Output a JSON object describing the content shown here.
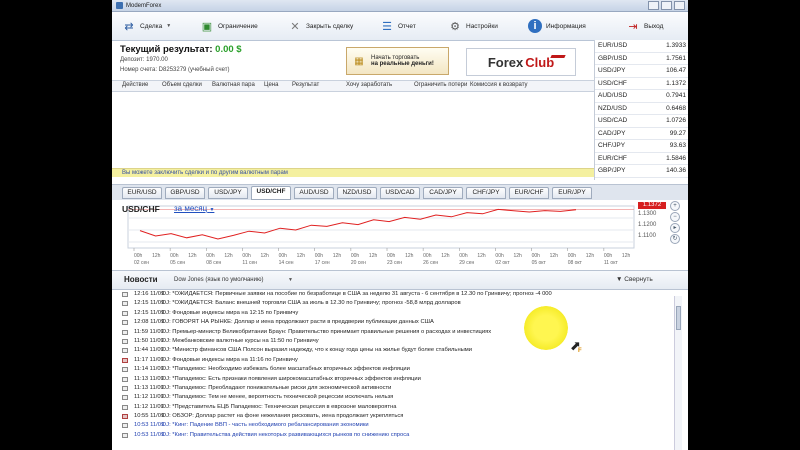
{
  "window": {
    "title": "ModemForex"
  },
  "toolbar": [
    {
      "label": "Сделка",
      "icon": "deal-icon",
      "caret": true
    },
    {
      "label": "Ограничение",
      "icon": "limit-icon",
      "caret": false
    },
    {
      "label": "Закрыть сделку",
      "icon": "close-deal-icon",
      "caret": false
    },
    {
      "label": "Отчет",
      "icon": "report-icon",
      "caret": false
    },
    {
      "label": "Настройки",
      "icon": "settings-icon",
      "caret": false
    },
    {
      "label": "Информация",
      "icon": "info-icon",
      "caret": false
    },
    {
      "label": "Выход",
      "icon": "exit-icon",
      "caret": false
    }
  ],
  "result": {
    "label": "Текущий результат:",
    "value": "0.00 $",
    "deposit": "Депозит: 1970.00",
    "account": "Номер счета: D8253279 (учебный счет)"
  },
  "promo": {
    "line1": "Начать торговать",
    "line2": "на реальные деньги!"
  },
  "logo": {
    "text1": "Forex",
    "text2": "Club"
  },
  "deals_header": [
    "Действие",
    "Объем сделки",
    "Валютная пара",
    "Цена",
    "Результат",
    "Хочу заработать",
    "Ограничить потери",
    "Комиссия к возврату"
  ],
  "more_deals": "Вы можете заключить сделки и по другим валютным парам",
  "rates": [
    {
      "pair": "EUR/USD",
      "price": "1.3933"
    },
    {
      "pair": "GBP/USD",
      "price": "1.7561"
    },
    {
      "pair": "USD/JPY",
      "price": "106.47"
    },
    {
      "pair": "USD/CHF",
      "price": "1.1372"
    },
    {
      "pair": "AUD/USD",
      "price": "0.7941"
    },
    {
      "pair": "NZD/USD",
      "price": "0.6468"
    },
    {
      "pair": "USD/CAD",
      "price": "1.0726"
    },
    {
      "pair": "CAD/JPY",
      "price": "99.27"
    },
    {
      "pair": "CHF/JPY",
      "price": "93.63"
    },
    {
      "pair": "EUR/CHF",
      "price": "1.5846"
    },
    {
      "pair": "GBP/JPY",
      "price": "140.36"
    }
  ],
  "tabs": [
    "EUR/USD",
    "GBP/USD",
    "USD/JPY",
    "USD/CHF",
    "AUD/USD",
    "NZD/USD",
    "USD/CAD",
    "CAD/JPY",
    "CHF/JPY",
    "EUR/CHF",
    "EUR/JPY"
  ],
  "active_tab": "USD/CHF",
  "chart": {
    "pair_label": "USD/CHF",
    "period": "за месяц",
    "current_price": "1.1372",
    "y_ticks": [
      "1.1300",
      "1.1200",
      "1.1100"
    ],
    "x_date_labels": [
      "02 сен",
      "05 сен",
      "08 сен",
      "11 сен",
      "14 сен",
      "17 сен",
      "20 сен",
      "23 сен",
      "26 сен",
      "29 сен",
      "02 окт",
      "05 окт",
      "08 окт",
      "11 окт"
    ],
    "x_time_labels": [
      "00h",
      "12h"
    ],
    "line_color": "#e02020"
  },
  "chart_data": {
    "type": "line",
    "title": "USD/CHF за месяц",
    "x_labels": [
      "02 сен",
      "05 сен",
      "08 сен",
      "11 сен",
      "14 сен",
      "17 сен",
      "20 сен",
      "23 сен",
      "26 сен",
      "29 сен",
      "02 окт",
      "05 окт",
      "08 окт",
      "11 окт"
    ],
    "ylim": [
      1.105,
      1.14
    ],
    "y_ticks": [
      1.11,
      1.12,
      1.13
    ],
    "series": [
      {
        "values": [
          1.1195,
          1.115,
          1.117,
          1.1135,
          1.116,
          1.1125,
          1.1155,
          1.119,
          1.1175,
          1.1215,
          1.12,
          1.124,
          1.123,
          1.126,
          1.1245,
          1.1285,
          1.127,
          1.1305,
          1.129,
          1.1325,
          1.131,
          1.1345,
          1.1335,
          1.1372,
          1.136,
          1.135,
          1.1362,
          1.1355,
          1.1368
        ]
      }
    ]
  },
  "news": {
    "title": "Новости",
    "source": "Dow Jones (язык по умолчанию)",
    "collapse": "Свернуть",
    "items": [
      {
        "time": "12:16 11/09",
        "text": "DJ: *ОЖИДАЕТСЯ: Первичные заявки на пособие по безработице в США за неделю 31 августа - 6 сентября в 12.30 по Гринвичу; прогноз -4 000",
        "red": false,
        "blue": false
      },
      {
        "time": "12:15 11/09",
        "text": "DJ: *ОЖИДАЕТСЯ: Баланс внешней торговли США за июль в 12.30 по Гринвичу; прогноз -58,8 млрд долларов",
        "red": false,
        "blue": false
      },
      {
        "time": "12:15 11/09",
        "text": "DJ: Фондовые индексы мира на 12:15 по Гринвичу",
        "red": false,
        "blue": false
      },
      {
        "time": "12:08 11/09",
        "text": "DJ: ГОВОРЯТ НА РЫНКЕ: Доллар и иена продолжают расти в преддверии публикации данных США",
        "red": false,
        "blue": false
      },
      {
        "time": "11:59 11/09",
        "text": "DJ: Премьер-министр Великобритании Браун: Правительство принимает правильные решения о расходах и инвестициях",
        "red": false,
        "blue": false
      },
      {
        "time": "11:50 11/09",
        "text": "DJ: Межбанковские валютные курсы на 11:50 по Гринвичу",
        "red": false,
        "blue": false
      },
      {
        "time": "11:44 11/09",
        "text": "DJ: *Министр финансов США Полсон выразил надежду, что к концу года цены на жилье будут более стабильными",
        "red": false,
        "blue": false
      },
      {
        "time": "11:17 11/09",
        "text": "DJ: Фондовые индексы мира на 11:16 по Гринвичу",
        "red": true,
        "blue": false
      },
      {
        "time": "11:14 11/09",
        "text": "DJ: *Пападемос: Необходимо избежать более масштабных вторичных эффектов инфляции",
        "red": false,
        "blue": false
      },
      {
        "time": "11:13 11/09",
        "text": "DJ: *Пападемос: Есть признаки появления широкомасштабных вторичных эффектов инфляции",
        "red": false,
        "blue": false
      },
      {
        "time": "11:13 11/09",
        "text": "DJ: *Пападемос: Преобладают понижательные риски для экономической активности",
        "red": false,
        "blue": false
      },
      {
        "time": "11:12 11/09",
        "text": "DJ: *Пападемос: Тем не менее, вероятность технической рецессии исключать нельзя",
        "red": false,
        "blue": false
      },
      {
        "time": "11:12 11/09",
        "text": "DJ: *Представитель ЕЦБ Пападемос: Техническая рецессия в еврозоне маловероятна",
        "red": false,
        "blue": false
      },
      {
        "time": "10:55 11/09",
        "text": "DJ: ОБЗОР: Доллар растет на фоне нежелания рисковать, иена продолжает укрепляться",
        "red": true,
        "blue": false
      },
      {
        "time": "10:53 11/09",
        "text": "DJ: *Кинг: Падение ВВП - часть необходимого ребалансирования экономики",
        "red": false,
        "blue": true
      },
      {
        "time": "10:53 11/09",
        "text": "DJ: *Кинг: Правительства действия некоторых развивающихся рынков по снижению спроса",
        "red": false,
        "blue": true
      }
    ]
  }
}
